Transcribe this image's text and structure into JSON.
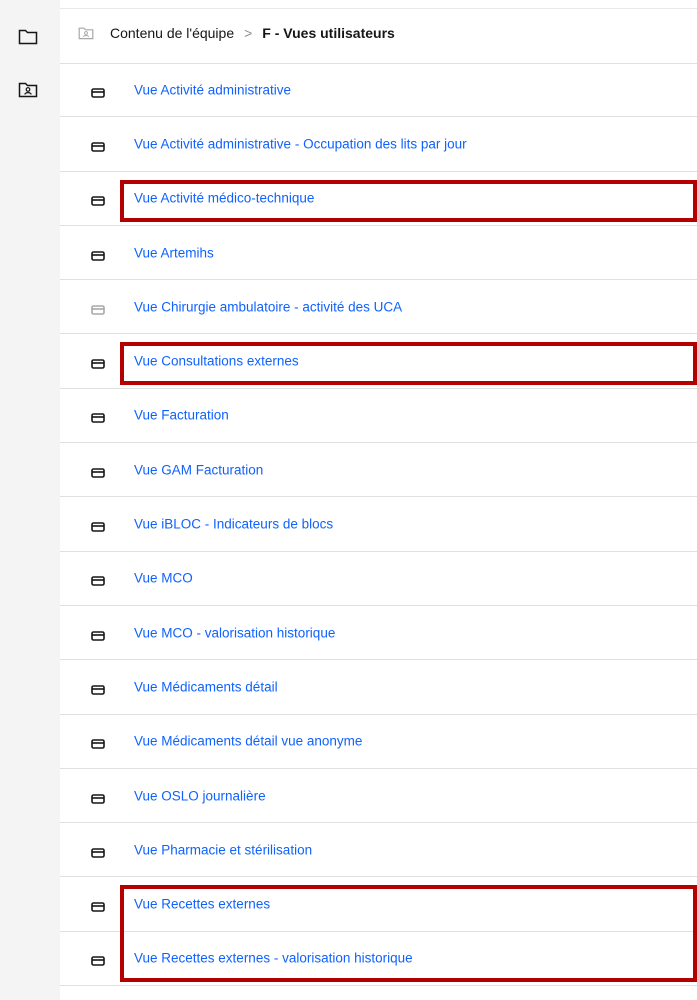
{
  "sidebar": {
    "items": [
      {
        "name": "folder",
        "icon": "folder-icon"
      },
      {
        "name": "team-content",
        "icon": "team-folder-icon"
      }
    ]
  },
  "breadcrumb": {
    "icon": "team-folder-icon",
    "parent": "Contenu de l'équipe",
    "separator": ">",
    "current": "F - Vues utilisateurs"
  },
  "items": [
    {
      "label": "Vue Activité administrative",
      "highlighted": false
    },
    {
      "label": "Vue Activité administrative - Occupation des lits par jour",
      "highlighted": false
    },
    {
      "label": "Vue Activité médico-technique",
      "highlighted": true
    },
    {
      "label": "Vue Artemihs",
      "highlighted": false
    },
    {
      "label": "Vue Chirurgie ambulatoire - activité des UCA",
      "highlighted": false,
      "icon_faded": true
    },
    {
      "label": "Vue Consultations externes",
      "highlighted": true
    },
    {
      "label": "Vue Facturation",
      "highlighted": false
    },
    {
      "label": "Vue GAM Facturation",
      "highlighted": false
    },
    {
      "label": "Vue iBLOC - Indicateurs de blocs",
      "highlighted": false
    },
    {
      "label": "Vue MCO",
      "highlighted": false
    },
    {
      "label": "Vue MCO - valorisation historique",
      "highlighted": false
    },
    {
      "label": "Vue Médicaments détail",
      "highlighted": false
    },
    {
      "label": "Vue Médicaments détail vue anonyme",
      "highlighted": false
    },
    {
      "label": "Vue OSLO journalière",
      "highlighted": false
    },
    {
      "label": "Vue Pharmacie et stérilisation",
      "highlighted": false
    },
    {
      "label": "Vue Recettes externes",
      "highlighted": true
    },
    {
      "label": "Vue Recettes externes - valorisation historique",
      "highlighted": true
    }
  ],
  "colors": {
    "link": "#0f62fe",
    "highlight": "#b30000",
    "icon": "#161616"
  }
}
